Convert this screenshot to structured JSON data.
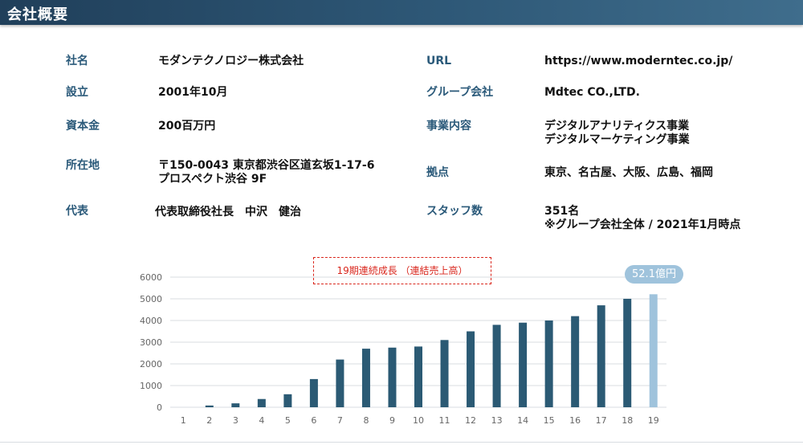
{
  "header": {
    "title": "会社概要"
  },
  "company": {
    "name_label": "社名",
    "name_value": "モダンテクノロジー株式会社",
    "established_label": "設立",
    "established_value": "2001年10月",
    "capital_label": "資本金",
    "capital_value": "200百万円",
    "address_label": "所在地",
    "address_line1": "〒150-0043 東京都渋谷区道玄坂1-17-6",
    "address_line2": "プロスペクト渋谷 9F",
    "representative_label": "代表",
    "representative_value": "代表取締役社長　中沢　健治",
    "url_label": "URL",
    "url_value": "https://www.moderntec.co.jp/",
    "group_label": "グループ会社",
    "group_value": "Mdtec CO.,LTD.",
    "business_label": "事業内容",
    "business_line1": "デジタルアナリティクス事業",
    "business_line2": "デジタルマーケティング事業",
    "bases_label": "拠点",
    "bases_value": "東京、名古屋、大阪、広島、福岡",
    "staff_label": "スタッフ数",
    "staff_line1": "351名",
    "staff_line2": "※グループ会社全体 / 2021年1月時点"
  },
  "chart_note": "19期連続成長 （連結売上高）",
  "chart_badge": "52.1億円",
  "chart_data": {
    "type": "bar",
    "categories": [
      "1",
      "2",
      "3",
      "4",
      "5",
      "6",
      "7",
      "8",
      "9",
      "10",
      "11",
      "12",
      "13",
      "14",
      "15",
      "16",
      "17",
      "18",
      "19"
    ],
    "values": [
      0,
      80,
      180,
      380,
      600,
      1300,
      2200,
      2700,
      2750,
      2800,
      3100,
      3500,
      3800,
      3900,
      4000,
      4200,
      4700,
      5000,
      5210
    ],
    "ylim": [
      0,
      6000
    ],
    "yticks": [
      0,
      1000,
      2000,
      3000,
      4000,
      5000,
      6000
    ],
    "grid": true,
    "colors": {
      "bar": "#2b5a74",
      "highlight": "#9fc3dc",
      "grid": "#d9dde1",
      "axis_text": "#666666"
    },
    "highlight_index": 18
  }
}
